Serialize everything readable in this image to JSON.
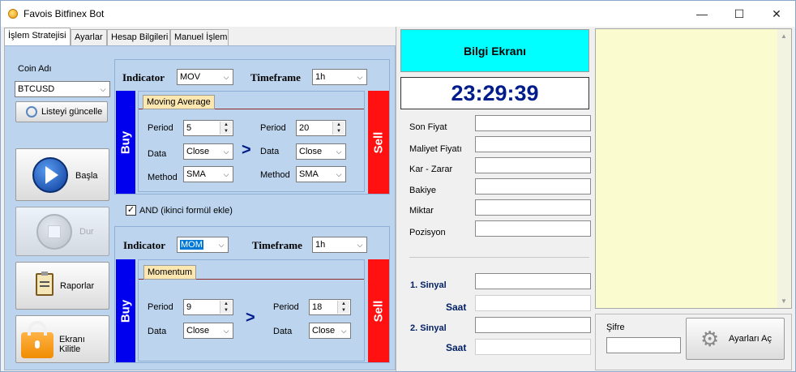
{
  "window": {
    "title": "Favois Bitfinex Bot",
    "minimize_glyph": "—",
    "maximize_glyph": "☐",
    "close_glyph": "✕"
  },
  "tabs": [
    "İşlem Stratejisi",
    "Ayarlar",
    "Hesap Bilgileri",
    "Manuel İşlem"
  ],
  "left": {
    "coin_label": "Coin Adı",
    "coin_value": "BTCUSD",
    "refresh_button": "Listeyi güncelle",
    "start_button": "Başla",
    "stop_button": "Dur",
    "reports_button": "Raporlar",
    "lock_button": "Ekranı Kilitle"
  },
  "strategy1": {
    "indicator_label": "Indicator",
    "indicator_value": "MOV",
    "timeframe_label": "Timeframe",
    "timeframe_value": "1h",
    "tab_name": "Moving Average",
    "buy_label": "Buy",
    "sell_label": "Sell",
    "left": {
      "period_label": "Period",
      "period_value": "5",
      "data_label": "Data",
      "data_value": "Close",
      "method_label": "Method",
      "method_value": "SMA"
    },
    "comparator": ">",
    "right": {
      "period_label": "Period",
      "period_value": "20",
      "data_label": "Data",
      "data_value": "Close",
      "method_label": "Method",
      "method_value": "SMA"
    }
  },
  "and_checkbox": {
    "label": "AND (ikinci formül ekle)",
    "checked": true,
    "check_glyph": "✓"
  },
  "strategy2": {
    "indicator_label": "Indicator",
    "indicator_value": "MOM",
    "timeframe_label": "Timeframe",
    "timeframe_value": "1h",
    "tab_name": "Momentum",
    "buy_label": "Buy",
    "sell_label": "Sell",
    "left": {
      "period_label": "Period",
      "period_value": "9",
      "data_label": "Data",
      "data_value": "Close"
    },
    "comparator": ">",
    "right": {
      "period_label": "Period",
      "period_value": "18",
      "data_label": "Data",
      "data_value": "Close"
    }
  },
  "info": {
    "header": "Bilgi Ekranı",
    "clock": "23:29:39",
    "fields": [
      "Son Fiyat",
      "Maliyet Fiyatı",
      "Kar - Zarar",
      "Bakiye",
      "Miktar",
      "Pozisyon"
    ],
    "signal1_label": "1. Sinyal",
    "time1_label": "Saat",
    "signal2_label": "2. Sinyal",
    "time2_label": "Saat"
  },
  "settings": {
    "password_label": "Şifre",
    "open_settings_button": "Ayarları Aç"
  },
  "colors": {
    "header_bg": "#00ffff",
    "clock_color": "#001b8a",
    "buy": "#0000ee",
    "sell": "#ff1111",
    "panel_blue": "#bcd4ee",
    "log_bg": "#fbfbd0"
  }
}
